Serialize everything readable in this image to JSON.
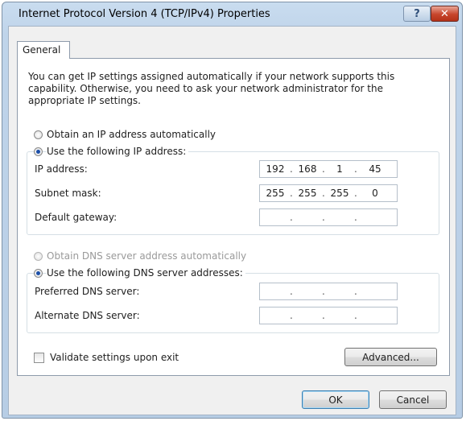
{
  "window": {
    "title": "Internet Protocol Version 4 (TCP/IPv4) Properties",
    "help_label": "?",
    "close_label": "✕"
  },
  "tabs": {
    "general": "General"
  },
  "description": "You can get IP settings assigned automatically if your network supports this capability. Otherwise, you need to ask your network administrator for the appropriate IP settings.",
  "ip": {
    "auto_label": "Obtain an IP address automatically",
    "manual_label": "Use the following IP address:",
    "selected": "manual",
    "fields": [
      {
        "label": "IP address:",
        "octets": [
          "192",
          "168",
          "1",
          "45"
        ]
      },
      {
        "label": "Subnet mask:",
        "octets": [
          "255",
          "255",
          "255",
          "0"
        ]
      },
      {
        "label": "Default gateway:",
        "octets": [
          "",
          "",
          "",
          ""
        ]
      }
    ]
  },
  "dns": {
    "auto_label": "Obtain DNS server address automatically",
    "manual_label": "Use the following DNS server addresses:",
    "selected": "manual",
    "fields": [
      {
        "label": "Preferred DNS server:",
        "octets": [
          "",
          "",
          "",
          ""
        ]
      },
      {
        "label": "Alternate DNS server:",
        "octets": [
          "",
          "",
          "",
          ""
        ]
      }
    ]
  },
  "validate": {
    "label": "Validate settings upon exit",
    "checked": false
  },
  "buttons": {
    "advanced": "Advanced...",
    "ok": "OK",
    "cancel": "Cancel"
  }
}
